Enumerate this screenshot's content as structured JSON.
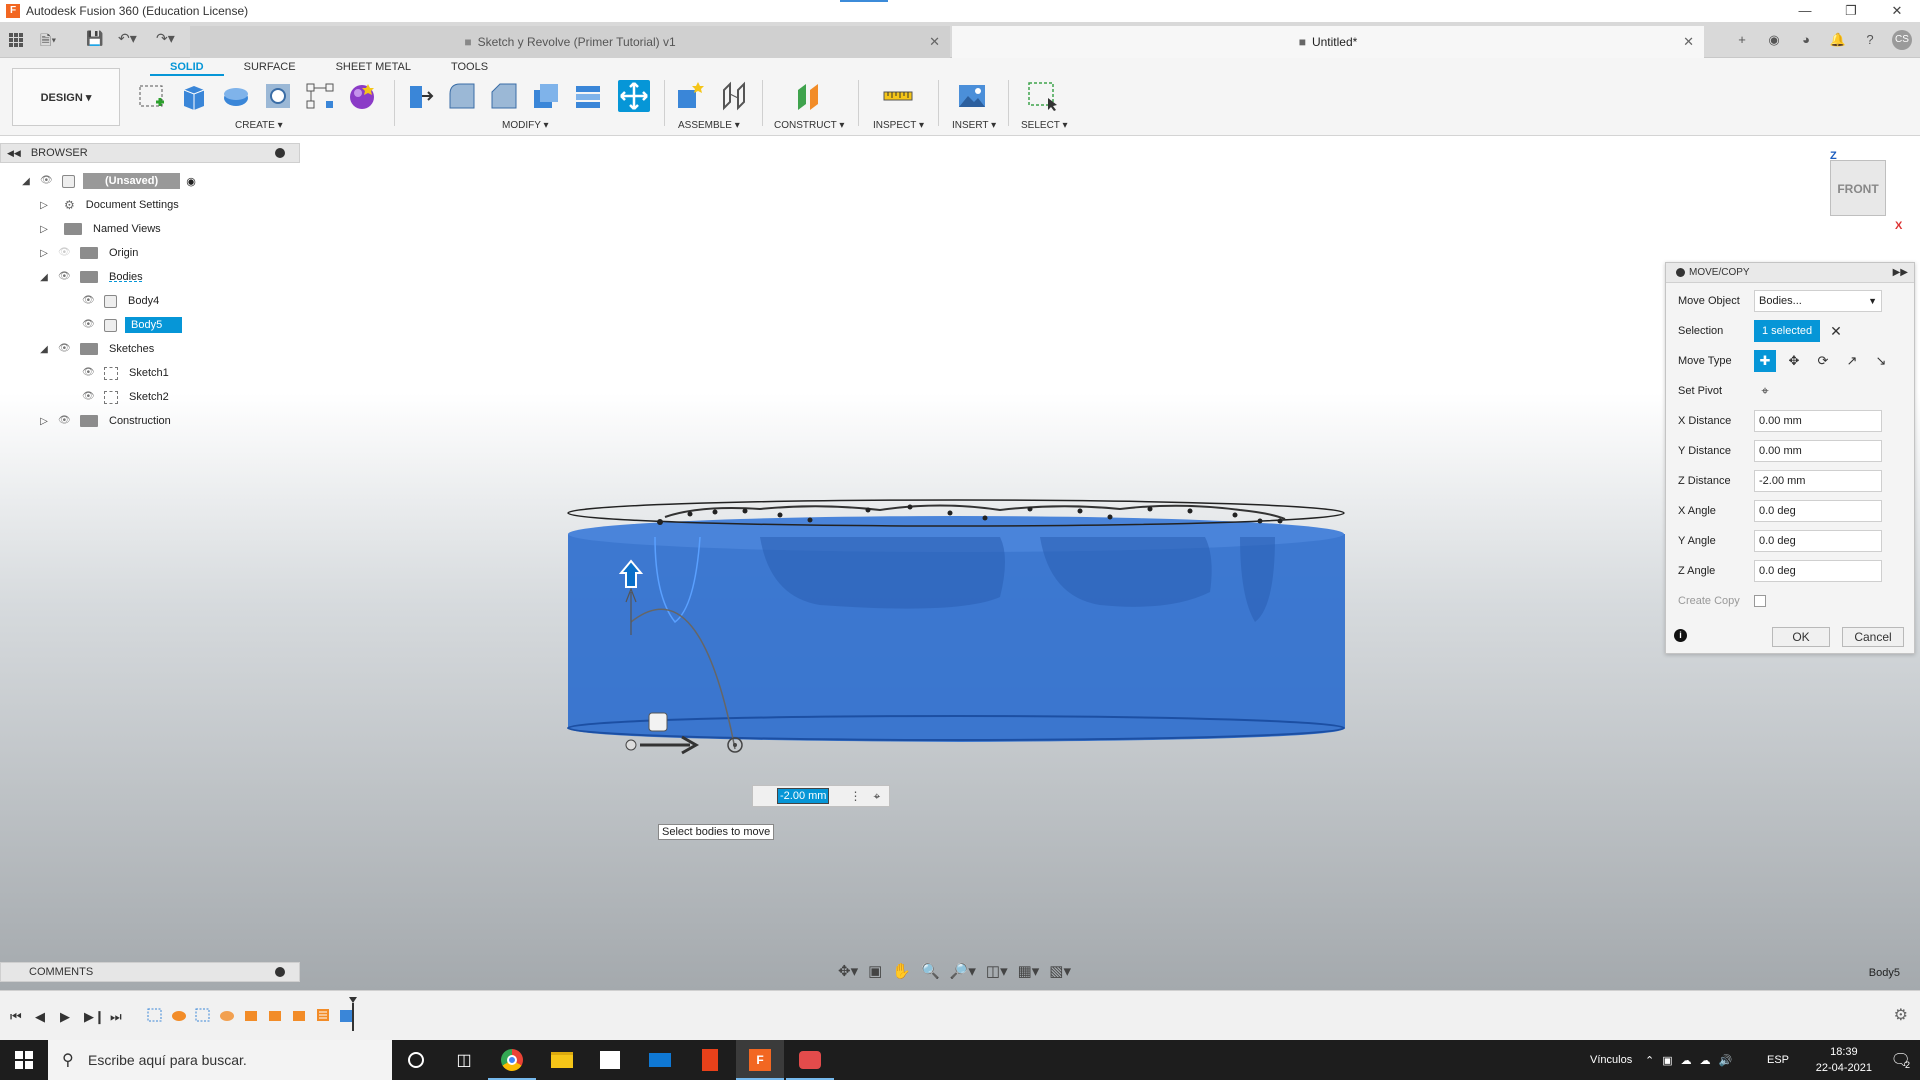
{
  "app": {
    "window_title": "Autodesk Fusion 360 (Education License)",
    "app_icon_letter": "F"
  },
  "tabs": [
    {
      "label": "Sketch y Revolve (Primer Tutorial) v1"
    },
    {
      "label": "Untitled*"
    }
  ],
  "user": {
    "initials": "CS"
  },
  "ribbon": {
    "workspace": "DESIGN ▾",
    "tabs": [
      "SOLID",
      "SURFACE",
      "SHEET METAL",
      "TOOLS"
    ],
    "active_tab": "SOLID",
    "groups": [
      "CREATE ▾",
      "MODIFY ▾",
      "ASSEMBLE ▾",
      "CONSTRUCT ▾",
      "INSPECT ▾",
      "INSERT ▾",
      "SELECT ▾"
    ]
  },
  "browser": {
    "header": "BROWSER",
    "root": "(Unsaved)",
    "items": [
      {
        "label": "Document Settings"
      },
      {
        "label": "Named Views"
      },
      {
        "label": "Origin"
      },
      {
        "label": "Bodies"
      },
      {
        "label": "Body4"
      },
      {
        "label": "Body5"
      },
      {
        "label": "Sketches"
      },
      {
        "label": "Sketch1"
      },
      {
        "label": "Sketch2"
      },
      {
        "label": "Construction"
      }
    ]
  },
  "viewcube": {
    "face": "FRONT",
    "z": "Z",
    "x": "X"
  },
  "move_copy": {
    "title": "MOVE/COPY",
    "move_object_label": "Move Object",
    "move_object_value": "Bodies...",
    "selection_label": "Selection",
    "selection_value": "1 selected",
    "move_type_label": "Move Type",
    "set_pivot_label": "Set Pivot",
    "x_distance_label": "X Distance",
    "x_distance": "0.00 mm",
    "y_distance_label": "Y Distance",
    "y_distance": "0.00 mm",
    "z_distance_label": "Z Distance",
    "z_distance": "-2.00 mm",
    "x_angle_label": "X Angle",
    "x_angle": "0.0 deg",
    "y_angle_label": "Y Angle",
    "y_angle": "0.0 deg",
    "z_angle_label": "Z Angle",
    "z_angle": "0.0 deg",
    "create_copy_label": "Create Copy",
    "ok": "OK",
    "cancel": "Cancel"
  },
  "canvas": {
    "inline_value": "-2.00 mm",
    "tooltip": "Select bodies to move"
  },
  "comments": {
    "label": "COMMENTS"
  },
  "status": {
    "selected_body": "Body5"
  },
  "taskbar": {
    "search_placeholder": "Escribe aquí para buscar.",
    "links_label": "Vínculos",
    "language": "ESP",
    "time": "18:39",
    "date": "22-04-2021",
    "notifications": "2"
  },
  "colors": {
    "accent": "#0696d7",
    "body_blue": "#2f6fce",
    "taskbar": "#1d1d1d"
  }
}
